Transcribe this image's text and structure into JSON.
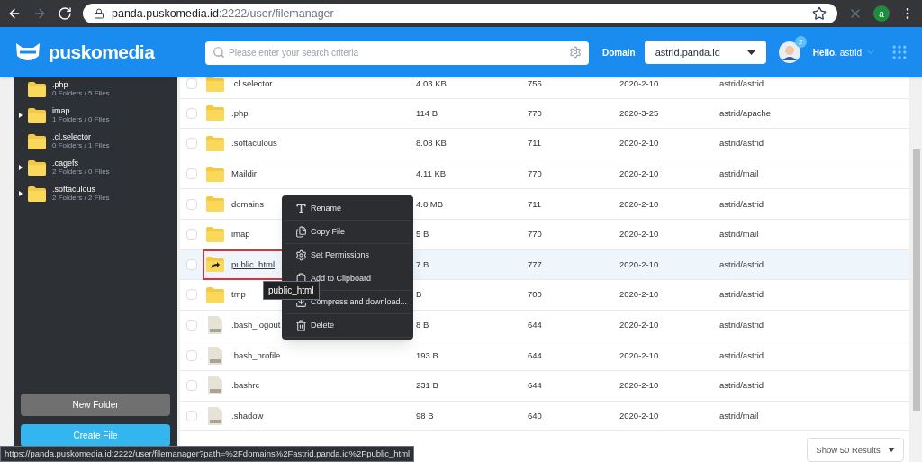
{
  "browser": {
    "url_host": "panda.puskomedia.id",
    "url_path": ":2222/user/filemanager",
    "profile_initial": "a"
  },
  "header": {
    "logo": "puskomedia",
    "search": {
      "placeholder": "Please enter your search criteria"
    },
    "domain_label": "Domain",
    "domain_value": "astrid.panda.id",
    "notification_count": "2",
    "greeting_prefix": "Hello,",
    "greeting_user": "astrid"
  },
  "sidebar": {
    "tree": [
      {
        "name": ".php",
        "info": "0 Folders / 5 Files",
        "has_children": false
      },
      {
        "name": "imap",
        "info": "1 Folders / 0 Files",
        "has_children": true
      },
      {
        "name": ".cl.selector",
        "info": "0 Folders / 1 Files",
        "has_children": false
      },
      {
        "name": ".cagefs",
        "info": "2 Folders / 0 Files",
        "has_children": true
      },
      {
        "name": ".softaculous",
        "info": "2 Folders / 2 Files",
        "has_children": true
      }
    ],
    "buttons": [
      "New Folder",
      "Create File"
    ]
  },
  "table": {
    "rows": [
      {
        "kind": "folder",
        "name": ".cl.selector",
        "size": "4.03 KB",
        "permissions": "755",
        "date": "2020-2-10",
        "owner": "astrid/astrid",
        "selected": false,
        "checked": false
      },
      {
        "kind": "folder",
        "name": ".php",
        "size": "114 B",
        "permissions": "770",
        "date": "2020-3-25",
        "owner": "astrid/apache",
        "selected": false,
        "checked": false
      },
      {
        "kind": "folder",
        "name": ".softaculous",
        "size": "8.08 KB",
        "permissions": "711",
        "date": "2020-2-10",
        "owner": "astrid/astrid",
        "selected": false,
        "checked": false
      },
      {
        "kind": "folder",
        "name": "Maildir",
        "size": "4.11 KB",
        "permissions": "770",
        "date": "2020-2-10",
        "owner": "astrid/mail",
        "selected": false,
        "checked": false
      },
      {
        "kind": "folder",
        "name": "domains",
        "size": "4.8 MB",
        "permissions": "711",
        "date": "2020-2-10",
        "owner": "astrid/astrid",
        "selected": false,
        "checked": false
      },
      {
        "kind": "folder",
        "name": "imap",
        "size": "5 B",
        "permissions": "770",
        "date": "2020-2-10",
        "owner": "astrid/mail",
        "selected": false,
        "checked": false
      },
      {
        "kind": "link",
        "name": "public_html",
        "size": "7 B",
        "permissions": "777",
        "date": "2020-2-10",
        "owner": "astrid/astrid",
        "selected": true,
        "checked": false
      },
      {
        "kind": "folder",
        "name": "tmp",
        "size": "B",
        "permissions": "700",
        "date": "2020-2-10",
        "owner": "astrid/astrid",
        "selected": false,
        "checked": false
      },
      {
        "kind": "file",
        "name": ".bash_logout",
        "size": "8 B",
        "permissions": "644",
        "date": "2020-2-10",
        "owner": "astrid/astrid",
        "selected": false,
        "checked": false
      },
      {
        "kind": "file",
        "name": ".bash_profile",
        "size": "193 B",
        "permissions": "644",
        "date": "2020-2-10",
        "owner": "astrid/astrid",
        "selected": false,
        "checked": false
      },
      {
        "kind": "file",
        "name": ".bashrc",
        "size": "231 B",
        "permissions": "644",
        "date": "2020-2-10",
        "owner": "astrid/astrid",
        "selected": false,
        "checked": false
      },
      {
        "kind": "file",
        "name": ".shadow",
        "size": "98 B",
        "permissions": "640",
        "date": "2020-2-10",
        "owner": "astrid/mail",
        "selected": false,
        "checked": false
      }
    ],
    "page_size": "Show 50 Results"
  },
  "context_menu": {
    "items": [
      {
        "kind": "rename",
        "label": "Rename"
      },
      {
        "kind": "copy",
        "label": "Copy File"
      },
      {
        "kind": "permissions",
        "label": "Set Permissions"
      },
      {
        "kind": "clipboard",
        "label": "Add to Clipboard"
      },
      {
        "kind": "download",
        "label": "Compress and download..."
      },
      {
        "kind": "delete",
        "label": "Delete"
      }
    ]
  },
  "tooltip": "public_html",
  "status_bar": "https://panda.puskomedia.id:2222/user/filemanager?path=%2Fdomains%2Fastrid.panda.id%2Fpublic_html"
}
